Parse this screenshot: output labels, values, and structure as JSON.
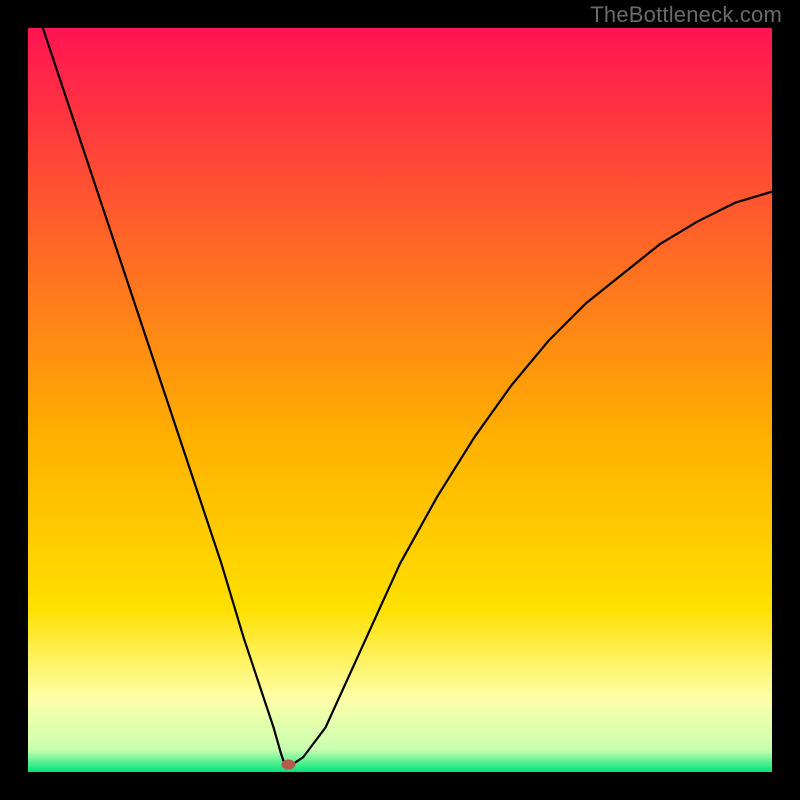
{
  "watermark": "TheBottleneck.com",
  "chart_data": {
    "type": "line",
    "title": "",
    "xlabel": "",
    "ylabel": "",
    "xlim": [
      0,
      100
    ],
    "ylim": [
      0,
      100
    ],
    "legend": false,
    "grid": false,
    "background_gradient": {
      "top_color": "#ff1452",
      "mid_color_top": "#ffd800",
      "mid_color_bottom": "#ffffc0",
      "bottom_color": "#00e47a"
    },
    "series": [
      {
        "name": "bottleneck-curve",
        "color": "#000000",
        "x": [
          2,
          6,
          10,
          14,
          18,
          22,
          26,
          29,
          31,
          33,
          34,
          34.5,
          35.5,
          37,
          40,
          45,
          50,
          55,
          60,
          65,
          70,
          75,
          80,
          85,
          90,
          95,
          100
        ],
        "y": [
          100,
          88,
          76,
          64,
          52,
          40,
          28,
          18,
          12,
          6,
          2.5,
          1,
          1,
          2,
          6,
          17,
          28,
          37,
          45,
          52,
          58,
          63,
          67,
          71,
          74,
          76.5,
          78
        ]
      }
    ],
    "marker": {
      "name": "optimal-point",
      "x": 35,
      "y": 1,
      "color": "#b85a4a",
      "rx": 7,
      "ry": 5
    }
  }
}
